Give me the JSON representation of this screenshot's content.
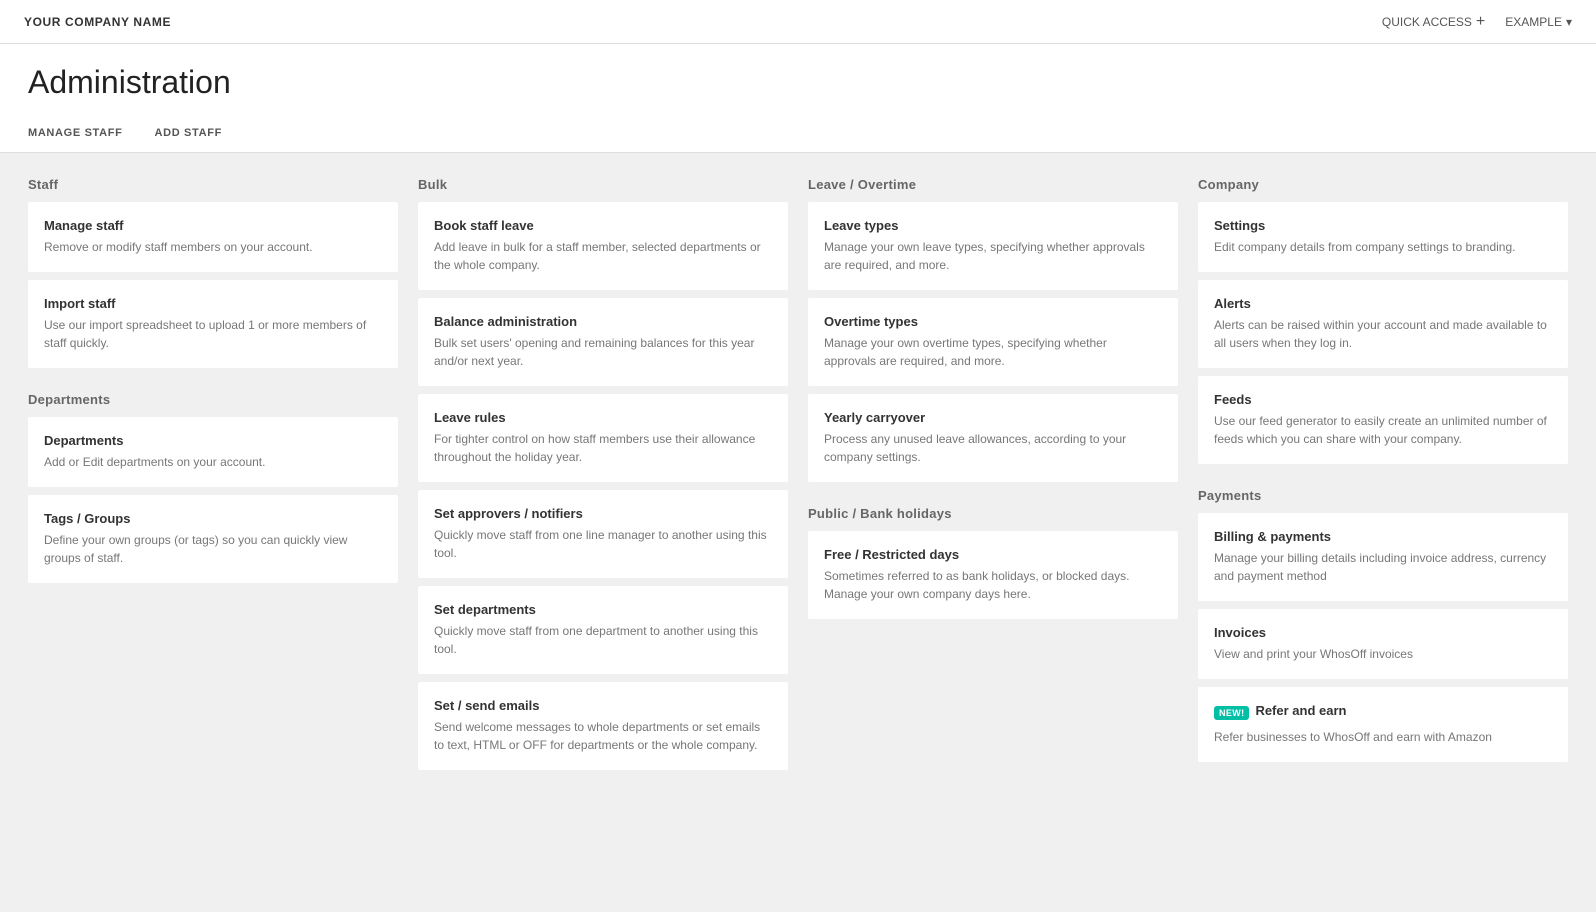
{
  "topnav": {
    "company_name": "YOUR COMPANY NAME",
    "quick_access_label": "QUICK ACCESS",
    "quick_access_plus": "+",
    "example_label": "EXAMPLE",
    "chevron_down": "▾"
  },
  "header": {
    "page_title": "Administration",
    "tabs": [
      {
        "label": "MANAGE STAFF",
        "id": "manage-staff"
      },
      {
        "label": "ADD STAFF",
        "id": "add-staff"
      }
    ]
  },
  "sections": {
    "staff": {
      "title": "Staff",
      "cards": [
        {
          "title": "Manage staff",
          "desc": "Remove or modify staff members on your account."
        },
        {
          "title": "Import staff",
          "desc": "Use our import spreadsheet to upload 1 or more members of staff quickly."
        }
      ],
      "sub_sections": [
        {
          "title": "Departments",
          "cards": [
            {
              "title": "Departments",
              "desc": "Add or Edit departments on your account."
            },
            {
              "title": "Tags / Groups",
              "desc": "Define your own groups (or tags) so you can quickly view groups of staff."
            }
          ]
        }
      ]
    },
    "bulk": {
      "title": "Bulk",
      "cards": [
        {
          "title": "Book staff leave",
          "desc": "Add leave in bulk for a staff member, selected departments or the whole company."
        },
        {
          "title": "Balance administration",
          "desc": "Bulk set users' opening and remaining balances for this year and/or next year."
        },
        {
          "title": "Leave rules",
          "desc": "For tighter control on how staff members use their allowance throughout the holiday year."
        },
        {
          "title": "Set approvers / notifiers",
          "desc": "Quickly move staff from one line manager to another using this tool."
        },
        {
          "title": "Set departments",
          "desc": "Quickly move staff from one department to another using this tool."
        },
        {
          "title": "Set / send emails",
          "desc": "Send welcome messages to whole departments or set emails to text, HTML or OFF for departments or the whole company."
        }
      ]
    },
    "leave_overtime": {
      "title": "Leave / Overtime",
      "cards": [
        {
          "title": "Leave types",
          "desc": "Manage your own leave types, specifying whether approvals are required, and more."
        },
        {
          "title": "Overtime types",
          "desc": "Manage your own overtime types, specifying whether approvals are required, and more."
        },
        {
          "title": "Yearly carryover",
          "desc": "Process any unused leave allowances, according to your company settings."
        }
      ],
      "sub_sections": [
        {
          "title": "Public / Bank holidays",
          "cards": [
            {
              "title": "Free / Restricted days",
              "desc": "Sometimes referred to as bank holidays, or blocked days. Manage your own company days here."
            }
          ]
        }
      ]
    },
    "company": {
      "title": "Company",
      "cards": [
        {
          "title": "Settings",
          "desc": "Edit company details from company settings to branding."
        },
        {
          "title": "Alerts",
          "desc": "Alerts can be raised within your account and made available to all users when they log in."
        },
        {
          "title": "Feeds",
          "desc": "Use our feed generator to easily create an unlimited number of feeds which you can share with your company."
        }
      ],
      "sub_sections": [
        {
          "title": "Payments",
          "cards": [
            {
              "title": "Billing & payments",
              "desc": "Manage your billing details including invoice address, currency and payment method"
            },
            {
              "title": "Invoices",
              "desc": "View and print your WhosOff invoices"
            },
            {
              "title": "Refer and earn",
              "desc": "Refer businesses to WhosOff and earn with Amazon",
              "badge": "New!"
            }
          ]
        }
      ]
    }
  }
}
